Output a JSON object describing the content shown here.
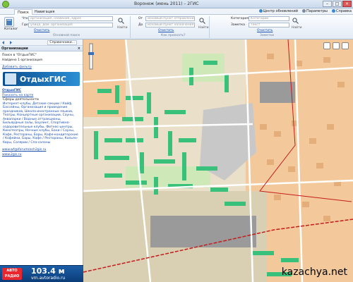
{
  "window": {
    "title": "Воронеж (июнь 2011) – 2ГИС",
    "minimize": "–",
    "maximize": "□",
    "close": "×"
  },
  "menu": {
    "tabs": [
      "Поиск",
      "Навигация"
    ],
    "right_links": [
      "Центр обновлений",
      "Параметры",
      "Справка"
    ]
  },
  "toolbar": {
    "search": {
      "what_label": "Что",
      "what_placeholder": "организация, название, адрес",
      "where_label": "Где",
      "where_placeholder": "улица, дом, организация",
      "catalog_label": "Каталог",
      "clear": "Очистить",
      "find": "Найти",
      "section": "Основной поиск"
    },
    "route": {
      "from_label": "От",
      "from_placeholder": "искомый пункт отправления",
      "to_label": "До",
      "to_placeholder": "искомый пункт назначения",
      "clear": "Очистить",
      "find": "Найти",
      "section": "Как проехать?"
    },
    "quick": {
      "category_label": "Категория",
      "category_placeholder": "Категории",
      "note_label": "Заметка",
      "note_placeholder": "Текст",
      "clear": "Очистить",
      "find": "Найти",
      "section": "Заметки"
    }
  },
  "left_panel": {
    "nav_dropdown": "Справочники...",
    "header": "Организации",
    "search_result_title": "Поиск в \"ОтдыхГИС\"",
    "search_result_count": "Найдено 1 организация",
    "add_filter": "Добавить фильтр",
    "banner_text": "ОтдыхГИС",
    "org_name": "ОтдыхГИС",
    "show_on_map": "Показать на карте",
    "rubrics_head": "Сферы деятельности",
    "rubrics": "Интернет-клубы, Детские секции / Кайф, Бассейны, Организация и проведение праздников, Школа иностранных языков, Театры, Концертные организации, Сауны, Аквапарки / Водные аттракционы, Бильярдные залы, Боулинг, Спортивно-оздоровительные клубы, Фитнес-центры, Кинотеатры, Ночные клубы, Бани / Сауны, Кафе, Рестораны, Бары, Кафе-кондитерские / Кофейни, Бары, Кафе / Рестораны, Кальян-бары, Солярии / Спа-салоны",
    "email_link": "www.wf@iforumzach2gis.ru",
    "site_link": "www.2gis.ru",
    "radio": {
      "logo": "АВТО РАДИО",
      "freq": "103.4 м",
      "url": "vrn.avtoradio.ru"
    }
  },
  "map": {
    "watermark": "kazachya.net",
    "colors": {
      "land": "#eadfc8",
      "residential": "#f3c99b",
      "buildings_green": "#39c07a",
      "industrial": "#9a9a9a",
      "park": "#cfe8b8",
      "road": "#ffffff",
      "rail": "#c41b1b"
    }
  }
}
